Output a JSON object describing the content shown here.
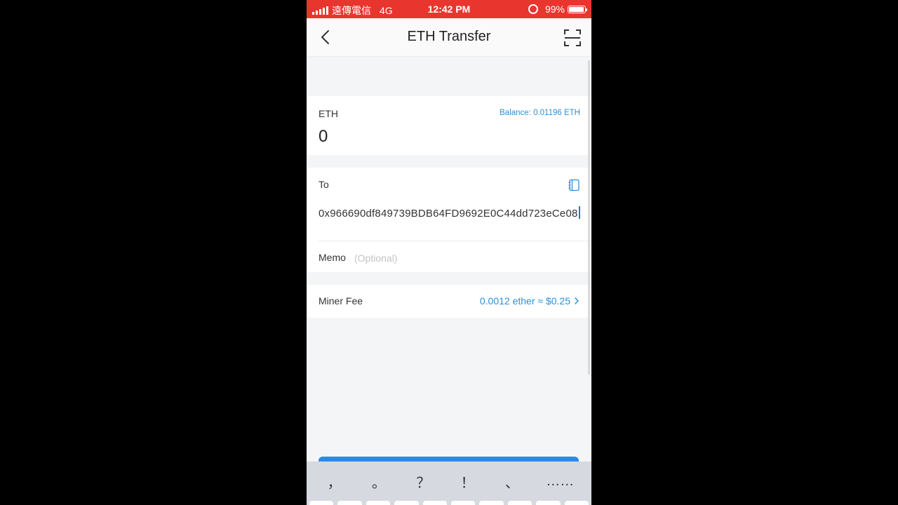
{
  "status_bar": {
    "carrier": "遠傳電信",
    "network": "4G",
    "time": "12:42 PM",
    "battery": "99%",
    "background_color": "#e8362e"
  },
  "nav": {
    "title": "ETH Transfer",
    "back_icon": "chevron-left-icon",
    "scan_icon": "scan-icon"
  },
  "amount": {
    "token": "ETH",
    "balance": "Balance: 0.01196 ETH",
    "value": "0"
  },
  "recipient": {
    "label": "To",
    "address": "0x966690df849739BDB64FD9692E0C44dd723eCe08",
    "address_book_icon": "address-book-icon"
  },
  "memo": {
    "label": "Memo",
    "placeholder": "(Optional)"
  },
  "fee": {
    "label": "Miner Fee",
    "value": "0.0012 ether ≈ $0.25"
  },
  "keyboard": {
    "suggestions": [
      "，",
      "。",
      "？",
      "！",
      "、",
      "……"
    ]
  },
  "colors": {
    "accent": "#2e8fd6",
    "button": "#2b8ae2"
  }
}
